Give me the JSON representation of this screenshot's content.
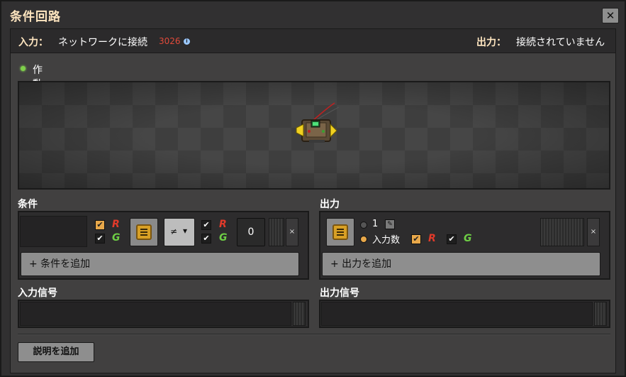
{
  "window": {
    "title": "条件回路",
    "close": "✕"
  },
  "status": {
    "input_label": "入力：",
    "input_text": "ネットワークに接続",
    "input_count": "3026",
    "info_icon": "i",
    "output_label": "出力：",
    "output_text": "接続されていません",
    "state_text": "作動中"
  },
  "conditions": {
    "label": "条件",
    "comparator": "≠",
    "constant": "0",
    "add_label": "+ 条件を追加",
    "remove": "×"
  },
  "outputs": {
    "label": "出力",
    "option_one": "1",
    "option_input_count": "入力数",
    "add_label": "+ 出力を追加",
    "remove": "×"
  },
  "input_signals": {
    "label": "入力信号"
  },
  "output_signals": {
    "label": "出力信号"
  },
  "footer": {
    "add_description": "説明を追加"
  },
  "icons": {
    "wire_red": "R",
    "wire_green": "G",
    "check": "✔",
    "pencil": "✎",
    "dropdown": "▾"
  },
  "colors": {
    "accent": "#e8a84a",
    "title": "#ffe6c0",
    "red_count": "#e04a3a",
    "status_green": "#7ed04a"
  }
}
